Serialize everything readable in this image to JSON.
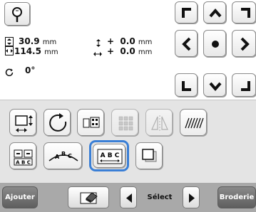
{
  "info": {
    "height_value": "30.9",
    "height_unit": "mm",
    "width_value": "114.5",
    "width_unit": "mm",
    "vert_offset_sign": "+",
    "vert_offset_value": "0.0",
    "vert_offset_unit": "mm",
    "horiz_offset_sign": "+",
    "horiz_offset_value": "0.0",
    "horiz_offset_unit": "mm",
    "rotation_value": "0°"
  },
  "bottom": {
    "add_label": "Ajouter",
    "select_label": "Sélect",
    "embroider_label": "Broderie"
  },
  "colors": {
    "accent": "#3a7fd6",
    "bottom_bar": "#a9a9a9",
    "tool_panel": "#e4e4e4"
  }
}
